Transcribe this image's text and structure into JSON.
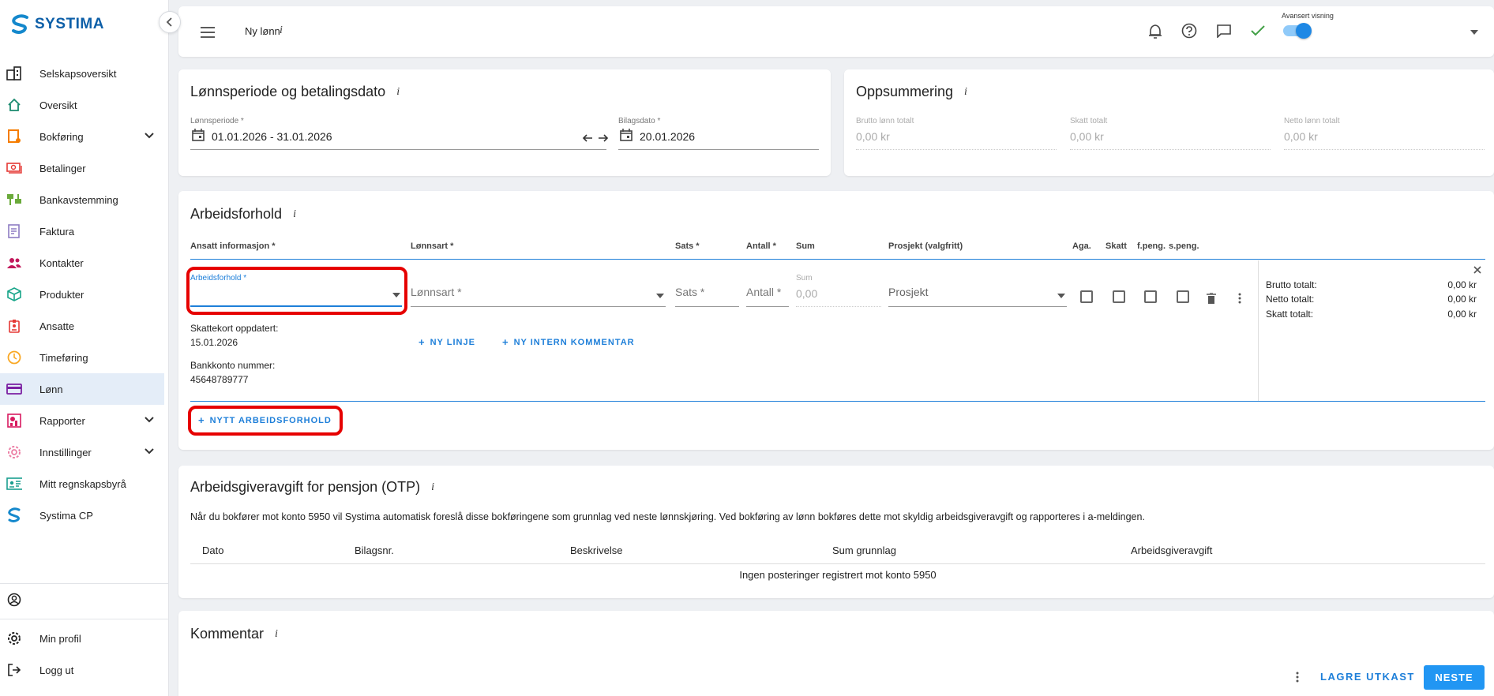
{
  "sidebar": {
    "logo": "SYSTIMA",
    "items": [
      {
        "label": "Selskapsoversikt",
        "icon": "building-icon"
      },
      {
        "label": "Oversikt",
        "icon": "home-icon"
      },
      {
        "label": "Bokføring",
        "icon": "ledger-icon",
        "expandable": true
      },
      {
        "label": "Betalinger",
        "icon": "money-icon"
      },
      {
        "label": "Bankavstemming",
        "icon": "bank-icon"
      },
      {
        "label": "Faktura",
        "icon": "invoice-icon"
      },
      {
        "label": "Kontakter",
        "icon": "contacts-icon"
      },
      {
        "label": "Produkter",
        "icon": "box-icon"
      },
      {
        "label": "Ansatte",
        "icon": "badge-icon"
      },
      {
        "label": "Timeføring",
        "icon": "clock-icon"
      },
      {
        "label": "Lønn",
        "icon": "card-icon",
        "active": true
      },
      {
        "label": "Rapporter",
        "icon": "reports-icon",
        "expandable": true
      },
      {
        "label": "Innstillinger",
        "icon": "gear-icon",
        "expandable": true
      },
      {
        "label": "Mitt regnskapsbyrå",
        "icon": "id-card-icon"
      },
      {
        "label": "Systima CP",
        "icon": "systima-icon"
      }
    ],
    "bottom": {
      "profile": "Min profil",
      "logout": "Logg ut"
    }
  },
  "topbar": {
    "title": "Ny lønn",
    "info": "i",
    "toggle_label": "Avansert visning"
  },
  "period_card": {
    "title": "Lønnsperiode og betalingsdato",
    "info": "i",
    "period_label": "Lønnsperiode *",
    "period_value": "01.01.2026 - 31.01.2026",
    "bilag_label": "Bilagsdato *",
    "bilag_value": "20.01.2026"
  },
  "summary_card": {
    "title": "Oppsummering",
    "info": "i",
    "fields": [
      {
        "label": "Brutto lønn totalt",
        "value": "0,00 kr"
      },
      {
        "label": "Skatt totalt",
        "value": "0,00 kr"
      },
      {
        "label": "Netto lønn totalt",
        "value": "0,00 kr"
      }
    ]
  },
  "arbeid_card": {
    "title": "Arbeidsforhold",
    "info": "i",
    "headers": {
      "ansatt": "Ansatt informasjon *",
      "lonnsart": "Lønnsart *",
      "sats": "Sats *",
      "antall": "Antall *",
      "sum": "Sum",
      "prosjekt": "Prosjekt (valgfritt)",
      "aga": "Aga.",
      "skatt": "Skatt",
      "fpeng": "f.peng.",
      "speng": "s.peng."
    },
    "arbeidsforhold_label": "Arbeidsforhold *",
    "lonnsart_placeholder": "Lønnsart *",
    "sats_placeholder": "Sats *",
    "antall_placeholder": "Antall *",
    "sum_label": "Sum",
    "sum_value": "0,00",
    "prosjekt_placeholder": "Prosjekt",
    "skattekort_label": "Skattekort oppdatert:",
    "skattekort_value": "15.01.2026",
    "bankkonto_label": "Bankkonto nummer:",
    "bankkonto_value": "45648789777",
    "ny_linje": "NY LINJE",
    "ny_kommentar": "NY INTERN KOMMENTAR",
    "totals": [
      {
        "label": "Brutto totalt:",
        "value": "0,00 kr"
      },
      {
        "label": "Netto totalt:",
        "value": "0,00 kr"
      },
      {
        "label": "Skatt totalt:",
        "value": "0,00 kr"
      }
    ],
    "nytt_button": "NYTT ARBEIDSFORHOLD"
  },
  "otp_card": {
    "title": "Arbeidsgiveravgift for pensjon (OTP)",
    "info": "i",
    "description": "Når du bokfører mot konto 5950 vil Systima automatisk foreslå disse bokføringene som grunnlag ved neste lønnskjøring. Ved bokføring av lønn bokføres dette mot skyldig arbeidsgiveravgift og rapporteres i a-meldingen.",
    "columns": [
      "Dato",
      "Bilagsnr.",
      "Beskrivelse",
      "Sum grunnlag",
      "Arbeidsgiveravgift"
    ],
    "empty_text": "Ingen posteringer registrert mot konto 5950"
  },
  "comment_card": {
    "title": "Kommentar",
    "info": "i"
  },
  "footer": {
    "draft": "LAGRE UTKAST",
    "next": "NESTE"
  },
  "colors": {
    "accent": "#2196f3",
    "highlight": "#e60000",
    "active_nav": "#e4edf8"
  }
}
